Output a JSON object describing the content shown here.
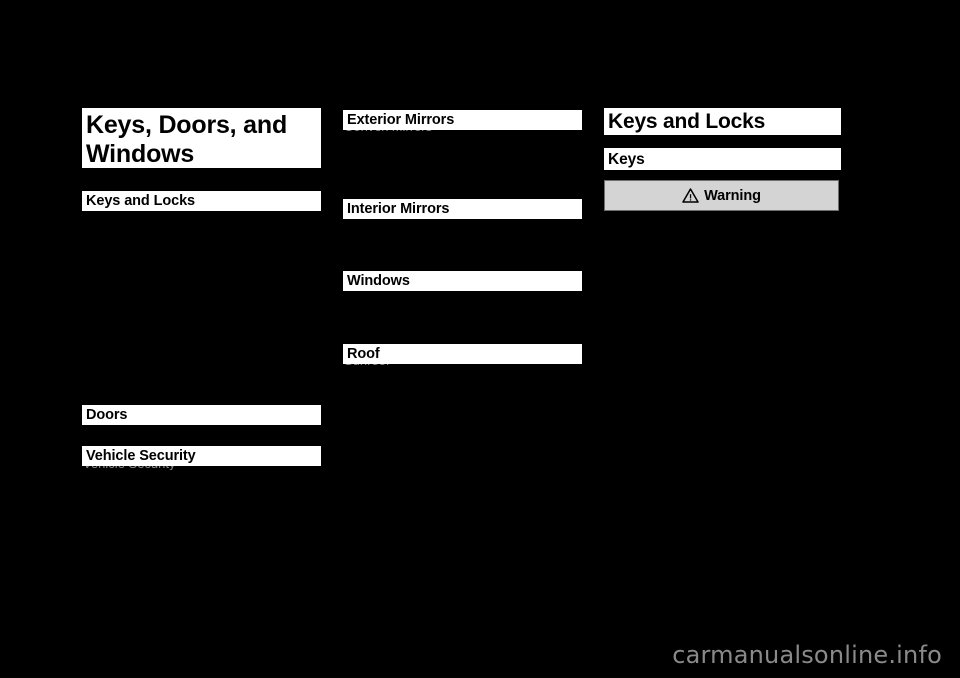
{
  "page": {
    "background_color": "#000000",
    "highlight_color": "#ffffff",
    "warning_box_color": "#d4d4d4",
    "warning_border_color": "#6e6e6e",
    "watermark_color": "#8a8a8a"
  },
  "chapter": {
    "title": "Keys, Doors, and Windows"
  },
  "columns": [
    {
      "id": "column-1",
      "sections": [
        {
          "id": "keys-and-locks",
          "label": "Keys and Locks"
        },
        {
          "id": "doors",
          "label": "Doors"
        },
        {
          "id": "vehicle-security",
          "label": "Vehicle Security",
          "clipped_line": "Vehicle Security"
        }
      ]
    },
    {
      "id": "column-2",
      "sections": [
        {
          "id": "exterior-mirrors",
          "label": "Exterior Mirrors",
          "clipped_line": "Convex Mirrors"
        },
        {
          "id": "interior-mirrors",
          "label": "Interior Mirrors"
        },
        {
          "id": "windows",
          "label": "Windows"
        },
        {
          "id": "roof",
          "label": "Roof",
          "clipped_line": "Sunroof"
        }
      ]
    },
    {
      "id": "column-3",
      "heading": "Keys and Locks",
      "subheading": "Keys",
      "warning": {
        "icon": "warning-triangle-icon",
        "label": "Warning"
      }
    }
  ],
  "watermark": {
    "text": "carmanualsonline.info"
  }
}
